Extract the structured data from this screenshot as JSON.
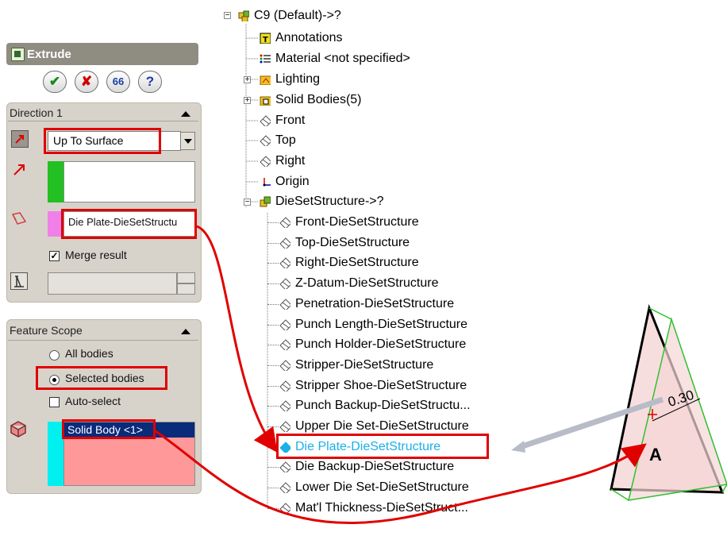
{
  "property_manager": {
    "title": "Extrude",
    "buttons": {
      "ok": "✔",
      "cancel": "✘",
      "preview": "66",
      "help": "?"
    },
    "direction1": {
      "header": "Direction 1",
      "end_condition": "Up To Surface",
      "face_selection": "Die Plate-DieSetStructu",
      "merge_result_label": "Merge result",
      "merge_result_checked": true
    },
    "feature_scope": {
      "header": "Feature Scope",
      "option_all": "All bodies",
      "option_selected": "Selected bodies",
      "selected_option": "Selected bodies",
      "auto_select_label": "Auto-select",
      "auto_select_checked": false,
      "bodies": [
        "Solid Body <1>"
      ]
    }
  },
  "tree": {
    "root": "C9  (Default)->?",
    "items": [
      {
        "label": "Annotations",
        "icon": "annotations-icon"
      },
      {
        "label": "Material <not specified>",
        "icon": "material-icon"
      },
      {
        "label": "Lighting",
        "icon": "lighting-folder-icon"
      },
      {
        "label": "Solid Bodies(5)",
        "icon": "solid-bodies-folder-icon"
      },
      {
        "label": "Front",
        "icon": "plane-icon"
      },
      {
        "label": "Top",
        "icon": "plane-icon"
      },
      {
        "label": "Right",
        "icon": "plane-icon"
      },
      {
        "label": "Origin",
        "icon": "origin-icon"
      },
      {
        "label": "DieSetStructure->?",
        "icon": "part-icon"
      }
    ],
    "die_set_children": [
      "Front-DieSetStructure",
      "Top-DieSetStructure",
      "Right-DieSetStructure",
      "Z-Datum-DieSetStructure",
      "Penetration-DieSetStructure",
      "Punch Length-DieSetStructure",
      "Punch Holder-DieSetStructure",
      "Stripper-DieSetStructure",
      "Stripper Shoe-DieSetStructure",
      "Punch Backup-DieSetStructu...",
      "Upper Die Set-DieSetStructure",
      "Die Plate-DieSetStructure",
      "Die Backup-DieSetStructure",
      "Lower Die Set-DieSetStructure",
      "Mat'l Thickness-DieSetStruct..."
    ],
    "selected_child": "Die Plate-DieSetStructure"
  },
  "viewport": {
    "dimension_label": "0.30",
    "face_label": "A"
  },
  "colors": {
    "highlight_red": "#e00000",
    "selected_text": "#1ab0e8",
    "face_pink": "#f07a7a"
  }
}
